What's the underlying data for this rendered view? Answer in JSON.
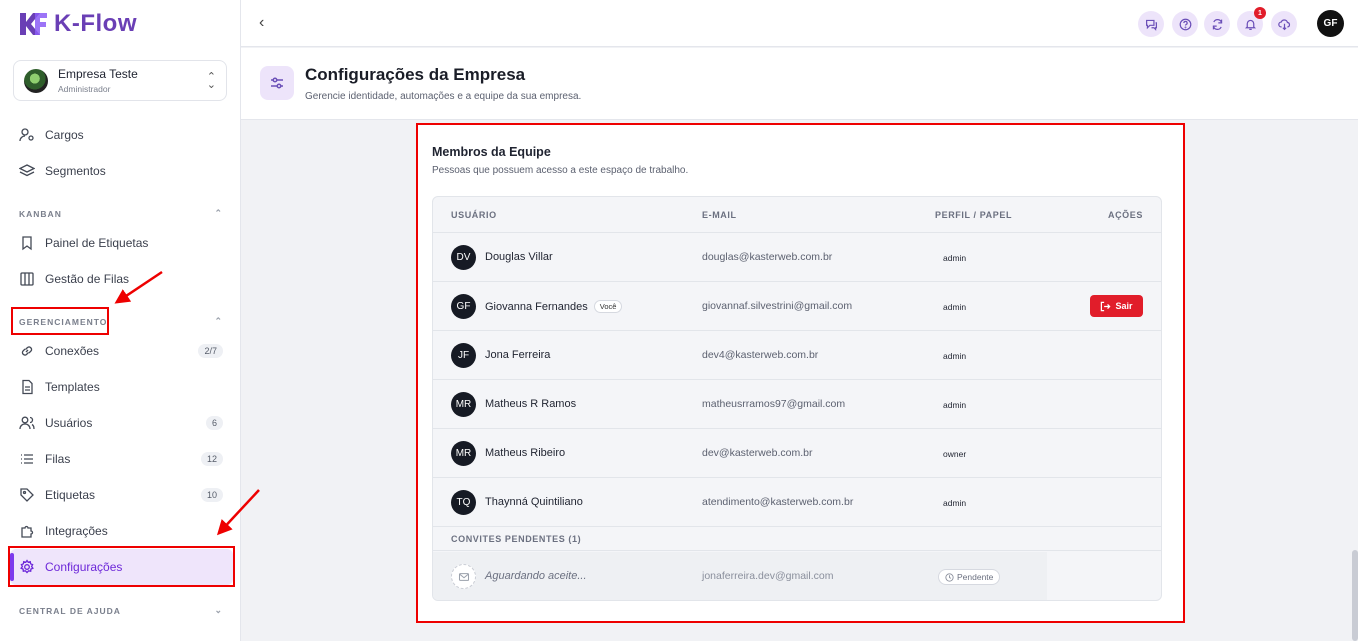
{
  "brand": {
    "name": "K-Flow"
  },
  "company": {
    "name": "Empresa Teste",
    "role": "Administrador"
  },
  "sidebar": {
    "items_top": [
      {
        "label": "Cargos",
        "icon": "user-cog-icon"
      },
      {
        "label": "Segmentos",
        "icon": "layers-icon"
      }
    ],
    "kanban": {
      "title": "KANBAN",
      "items": [
        {
          "label": "Painel de Etiquetas",
          "icon": "bookmark-icon"
        },
        {
          "label": "Gestão de Filas",
          "icon": "columns-icon"
        }
      ]
    },
    "gerenciamento": {
      "title": "GERENCIAMENTO",
      "items": [
        {
          "label": "Conexões",
          "icon": "link-icon",
          "badge": "2/7"
        },
        {
          "label": "Templates",
          "icon": "file-icon",
          "badge": ""
        },
        {
          "label": "Usuários",
          "icon": "users-icon",
          "badge": "6"
        },
        {
          "label": "Filas",
          "icon": "list-icon",
          "badge": "12"
        },
        {
          "label": "Etiquetas",
          "icon": "tag-icon",
          "badge": "10"
        },
        {
          "label": "Integrações",
          "icon": "puzzle-icon",
          "badge": ""
        },
        {
          "label": "Configurações",
          "icon": "gear-icon",
          "badge": "",
          "active": true
        }
      ]
    },
    "ajuda": {
      "title": "CENTRAL DE AJUDA"
    }
  },
  "topbar": {
    "notification_count": "1",
    "user_initials": "GF"
  },
  "page": {
    "title": "Configurações da Empresa",
    "subtitle": "Gerencie identidade, automações e a equipe da sua empresa."
  },
  "team": {
    "title": "Membros da Equipe",
    "subtitle": "Pessoas que possuem acesso a este espaço de trabalho.",
    "columns": [
      "USUÁRIO",
      "E-MAIL",
      "PERFIL / PAPEL",
      "AÇÕES"
    ],
    "members": [
      {
        "initials": "DV",
        "name": "Douglas Villar",
        "email": "douglas@kasterweb.com.br",
        "role": "admin",
        "you": "",
        "action": ""
      },
      {
        "initials": "GF",
        "name": "Giovanna Fernandes",
        "email": "giovannaf.silvestrini@gmail.com",
        "role": "admin",
        "you": "Você",
        "action": "Sair"
      },
      {
        "initials": "JF",
        "name": "Jona Ferreira",
        "email": "dev4@kasterweb.com.br",
        "role": "admin",
        "you": "",
        "action": ""
      },
      {
        "initials": "MR",
        "name": "Matheus R Ramos",
        "email": "matheusrramos97@gmail.com",
        "role": "admin",
        "you": "",
        "action": ""
      },
      {
        "initials": "MR",
        "name": "Matheus Ribeiro",
        "email": "dev@kasterweb.com.br",
        "role": "owner",
        "you": "",
        "action": ""
      },
      {
        "initials": "TQ",
        "name": "Thaynná Quintiliano",
        "email": "atendimento@kasterweb.com.br",
        "role": "admin",
        "you": "",
        "action": ""
      }
    ],
    "pending_title": "CONVITES PENDENTES (1)",
    "pending": [
      {
        "name": "Aguardando aceite...",
        "email": "jonaferreira.dev@gmail.com",
        "status": "Pendente"
      }
    ]
  }
}
